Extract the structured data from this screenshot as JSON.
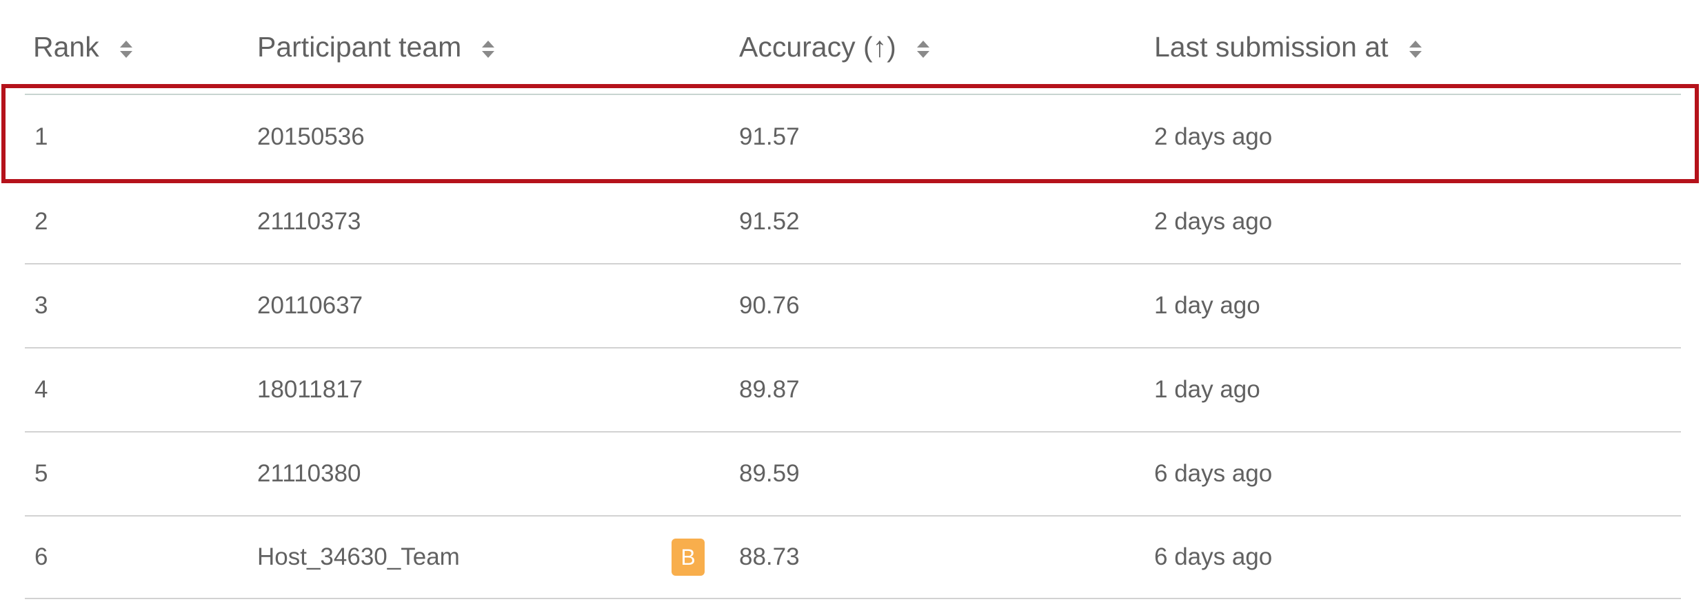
{
  "columns": {
    "rank": "Rank",
    "team": "Participant team",
    "accuracy": "Accuracy (↑)",
    "last_submission": "Last submission at"
  },
  "sort_icon": "sort-updown-icon",
  "colors": {
    "highlight_border": "#b5121b",
    "badge": "#f8ae4c",
    "text": "#616161",
    "divider": "#d2d2d2"
  },
  "rows": [
    {
      "rank": "1",
      "team": "20150536",
      "accuracy": "91.57",
      "last_submission": "2 days ago",
      "highlighted": true
    },
    {
      "rank": "2",
      "team": "21110373",
      "accuracy": "91.52",
      "last_submission": "2 days ago"
    },
    {
      "rank": "3",
      "team": "20110637",
      "accuracy": "90.76",
      "last_submission": "1 day ago"
    },
    {
      "rank": "4",
      "team": "18011817",
      "accuracy": "89.87",
      "last_submission": "1 day ago"
    },
    {
      "rank": "5",
      "team": "21110380",
      "accuracy": "89.59",
      "last_submission": "6 days ago"
    },
    {
      "rank": "6",
      "team": "Host_34630_Team",
      "accuracy": "88.73",
      "last_submission": "6 days ago",
      "badge": "B"
    }
  ]
}
